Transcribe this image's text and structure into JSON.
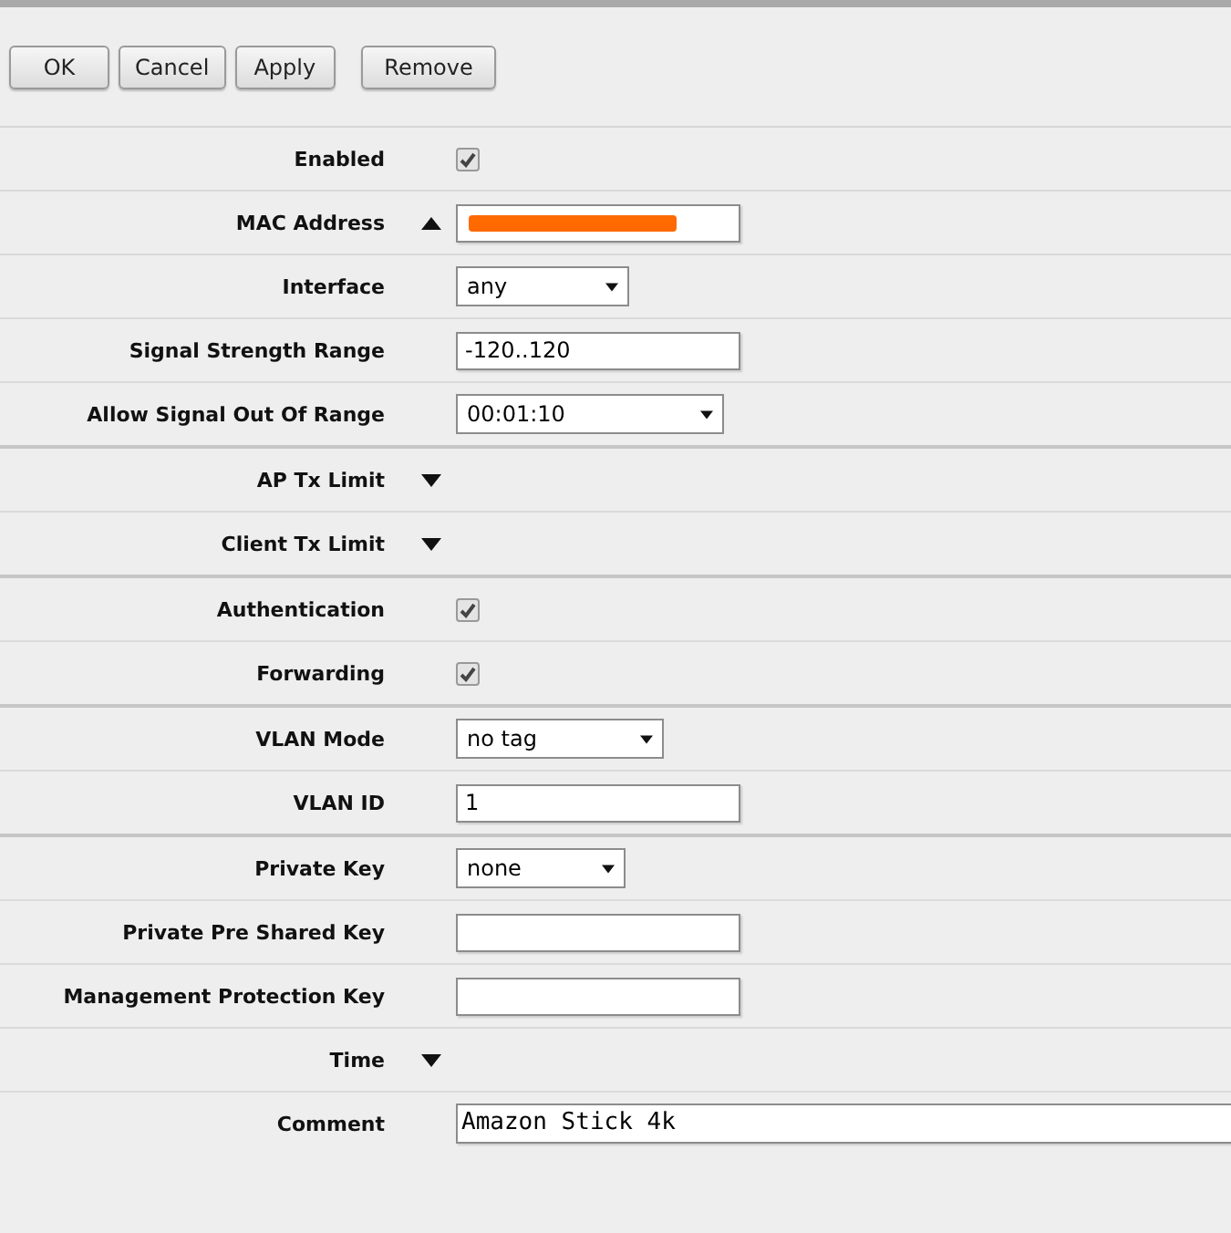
{
  "button_groups": [
    {
      "buttons": [
        "OK",
        "Cancel",
        "Apply"
      ]
    },
    {
      "buttons": [
        "Remove"
      ]
    }
  ],
  "sections": [
    {
      "rows": [
        {
          "kind": "checkbox",
          "label": "Enabled",
          "checked": true
        },
        {
          "kind": "text",
          "label": "MAC Address",
          "expanded": true,
          "redacted": true
        },
        {
          "kind": "select",
          "label": "Interface",
          "value": "any"
        },
        {
          "kind": "text",
          "label": "Signal Strength Range",
          "value": "-120..120"
        },
        {
          "kind": "select",
          "label": "Allow Signal Out Of Range",
          "value": "00:01:10"
        }
      ]
    },
    {
      "rows": [
        {
          "kind": "expander",
          "label": "AP Tx Limit",
          "expanded": false
        },
        {
          "kind": "expander",
          "label": "Client Tx Limit",
          "expanded": false
        }
      ]
    },
    {
      "rows": [
        {
          "kind": "checkbox",
          "label": "Authentication",
          "checked": true
        },
        {
          "kind": "checkbox",
          "label": "Forwarding",
          "checked": true
        }
      ]
    },
    {
      "rows": [
        {
          "kind": "select",
          "label": "VLAN Mode",
          "value": "no tag"
        },
        {
          "kind": "text",
          "label": "VLAN ID",
          "value": "1"
        }
      ]
    },
    {
      "rows": [
        {
          "kind": "select",
          "label": "Private Key",
          "value": "none"
        },
        {
          "kind": "text",
          "label": "Private Pre Shared Key"
        },
        {
          "kind": "text",
          "label": "Management Protection Key"
        },
        {
          "kind": "expander",
          "label": "Time",
          "expanded": false
        },
        {
          "kind": "comment",
          "label": "Comment",
          "value": "Amazon Stick 4k"
        }
      ]
    }
  ]
}
